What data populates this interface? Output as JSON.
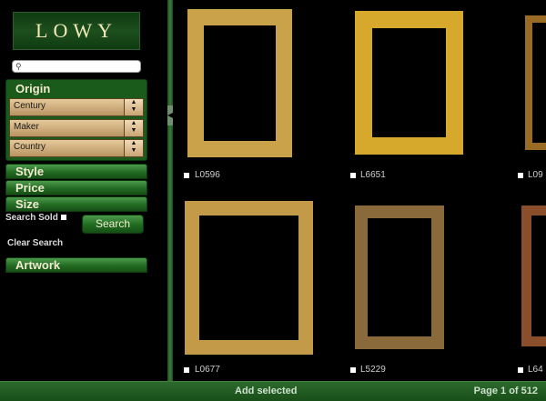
{
  "brand": {
    "logo_text": "LOWY"
  },
  "search": {
    "placeholder": ""
  },
  "filters": {
    "origin_title": "Origin",
    "selects": [
      {
        "label": "Century"
      },
      {
        "label": "Maker"
      },
      {
        "label": "Country"
      }
    ],
    "sections": [
      {
        "label": "Style"
      },
      {
        "label": "Price"
      },
      {
        "label": "Size"
      },
      {
        "label": "Artwork"
      }
    ],
    "search_sold_label": "Search Sold",
    "search_button": "Search",
    "clear_search": "Clear Search"
  },
  "results": [
    {
      "code": "L0596",
      "tone": "#c9a24a"
    },
    {
      "code": "L6651",
      "tone": "#d6a82c"
    },
    {
      "code": "L09",
      "tone": "#9a6b22"
    },
    {
      "code": "L0677",
      "tone": "#c29a48"
    },
    {
      "code": "L5229",
      "tone": "#8a6a3a"
    },
    {
      "code": "L64",
      "tone": "#8a4f2a"
    }
  ],
  "footer": {
    "add_selected": "Add selected",
    "pagination": "Page 1 of 512"
  }
}
